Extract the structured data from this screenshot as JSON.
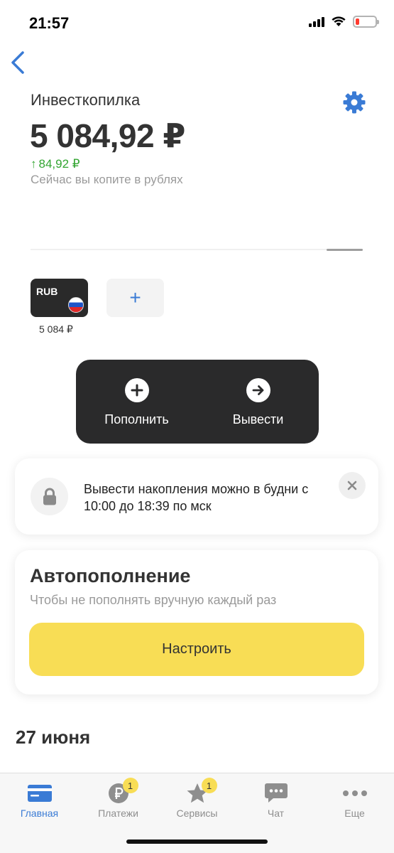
{
  "status_bar": {
    "time": "21:57"
  },
  "header": {
    "title": "Инвесткопилка",
    "balance": "5 084,92 ₽",
    "delta": "84,92 ₽",
    "subtitle": "Сейчас вы копите в рублях"
  },
  "currencies": [
    {
      "code": "RUB",
      "amount": "5 084 ₽"
    }
  ],
  "add_currency": {
    "label": "+"
  },
  "actions": {
    "top_up": "Пополнить",
    "withdraw": "Вывести"
  },
  "notice": {
    "text": "Вывести накопления можно в будни с 10:00 до 18:39 по мск"
  },
  "auto_top_up": {
    "title": "Автопополнение",
    "subtitle": "Чтобы не пополнять вручную каждый раз",
    "button": "Настроить"
  },
  "history": {
    "date": "27 июня"
  },
  "tab_bar": {
    "items": [
      {
        "label": "Главная",
        "icon": "card-icon",
        "active": true
      },
      {
        "label": "Платежи",
        "icon": "ruble-icon",
        "badge": "1"
      },
      {
        "label": "Сервисы",
        "icon": "star-icon",
        "badge": "1"
      },
      {
        "label": "Чат",
        "icon": "chat-icon"
      },
      {
        "label": "Еще",
        "icon": "more-icon"
      }
    ]
  },
  "colors": {
    "accent": "#3a7bd5",
    "positive": "#33a532",
    "button_yellow": "#f8dd55",
    "dark_panel": "#2a2a2b"
  }
}
